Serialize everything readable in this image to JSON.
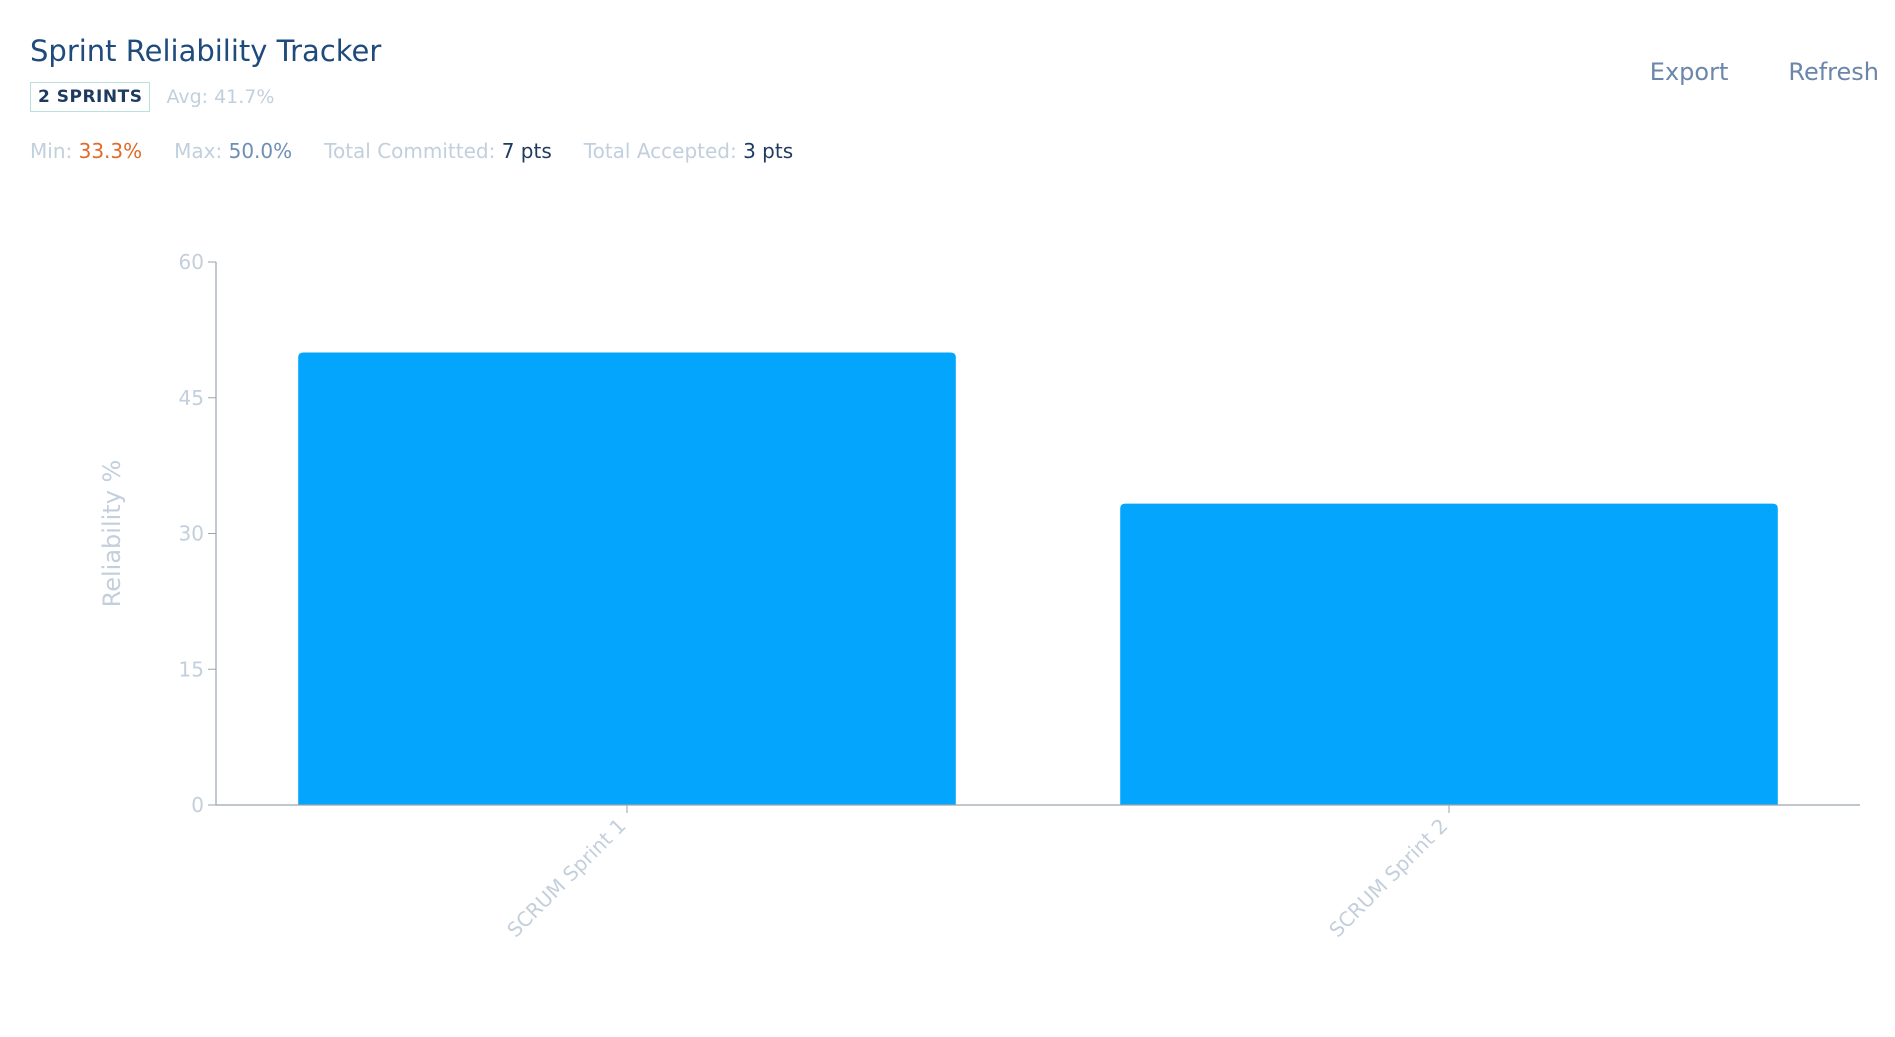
{
  "header": {
    "title": "Sprint Reliability Tracker",
    "badge": "2 SPRINTS",
    "avg_label": "Avg:",
    "avg_value": "41.7%"
  },
  "stats": {
    "min_label": "Min:",
    "min_value": "33.3%",
    "max_label": "Max:",
    "max_value": "50.0%",
    "committed_label": "Total Committed:",
    "committed_value": "7 pts",
    "accepted_label": "Total Accepted:",
    "accepted_value": "3 pts"
  },
  "actions": {
    "export_label": "Export",
    "refresh_label": "Refresh"
  },
  "colors": {
    "bar": "#04a6fd",
    "axis": "#9aa3ad",
    "tick_text": "#c3cfdc"
  },
  "chart_data": {
    "type": "bar",
    "categories": [
      "SCRUM Sprint 1",
      "SCRUM Sprint 2"
    ],
    "values": [
      50.0,
      33.3
    ],
    "title": "",
    "xlabel": "",
    "ylabel": "Reliability %",
    "ylim": [
      0,
      60
    ],
    "yticks": [
      0,
      15,
      30,
      45,
      60
    ],
    "grid": false,
    "legend": "none"
  }
}
